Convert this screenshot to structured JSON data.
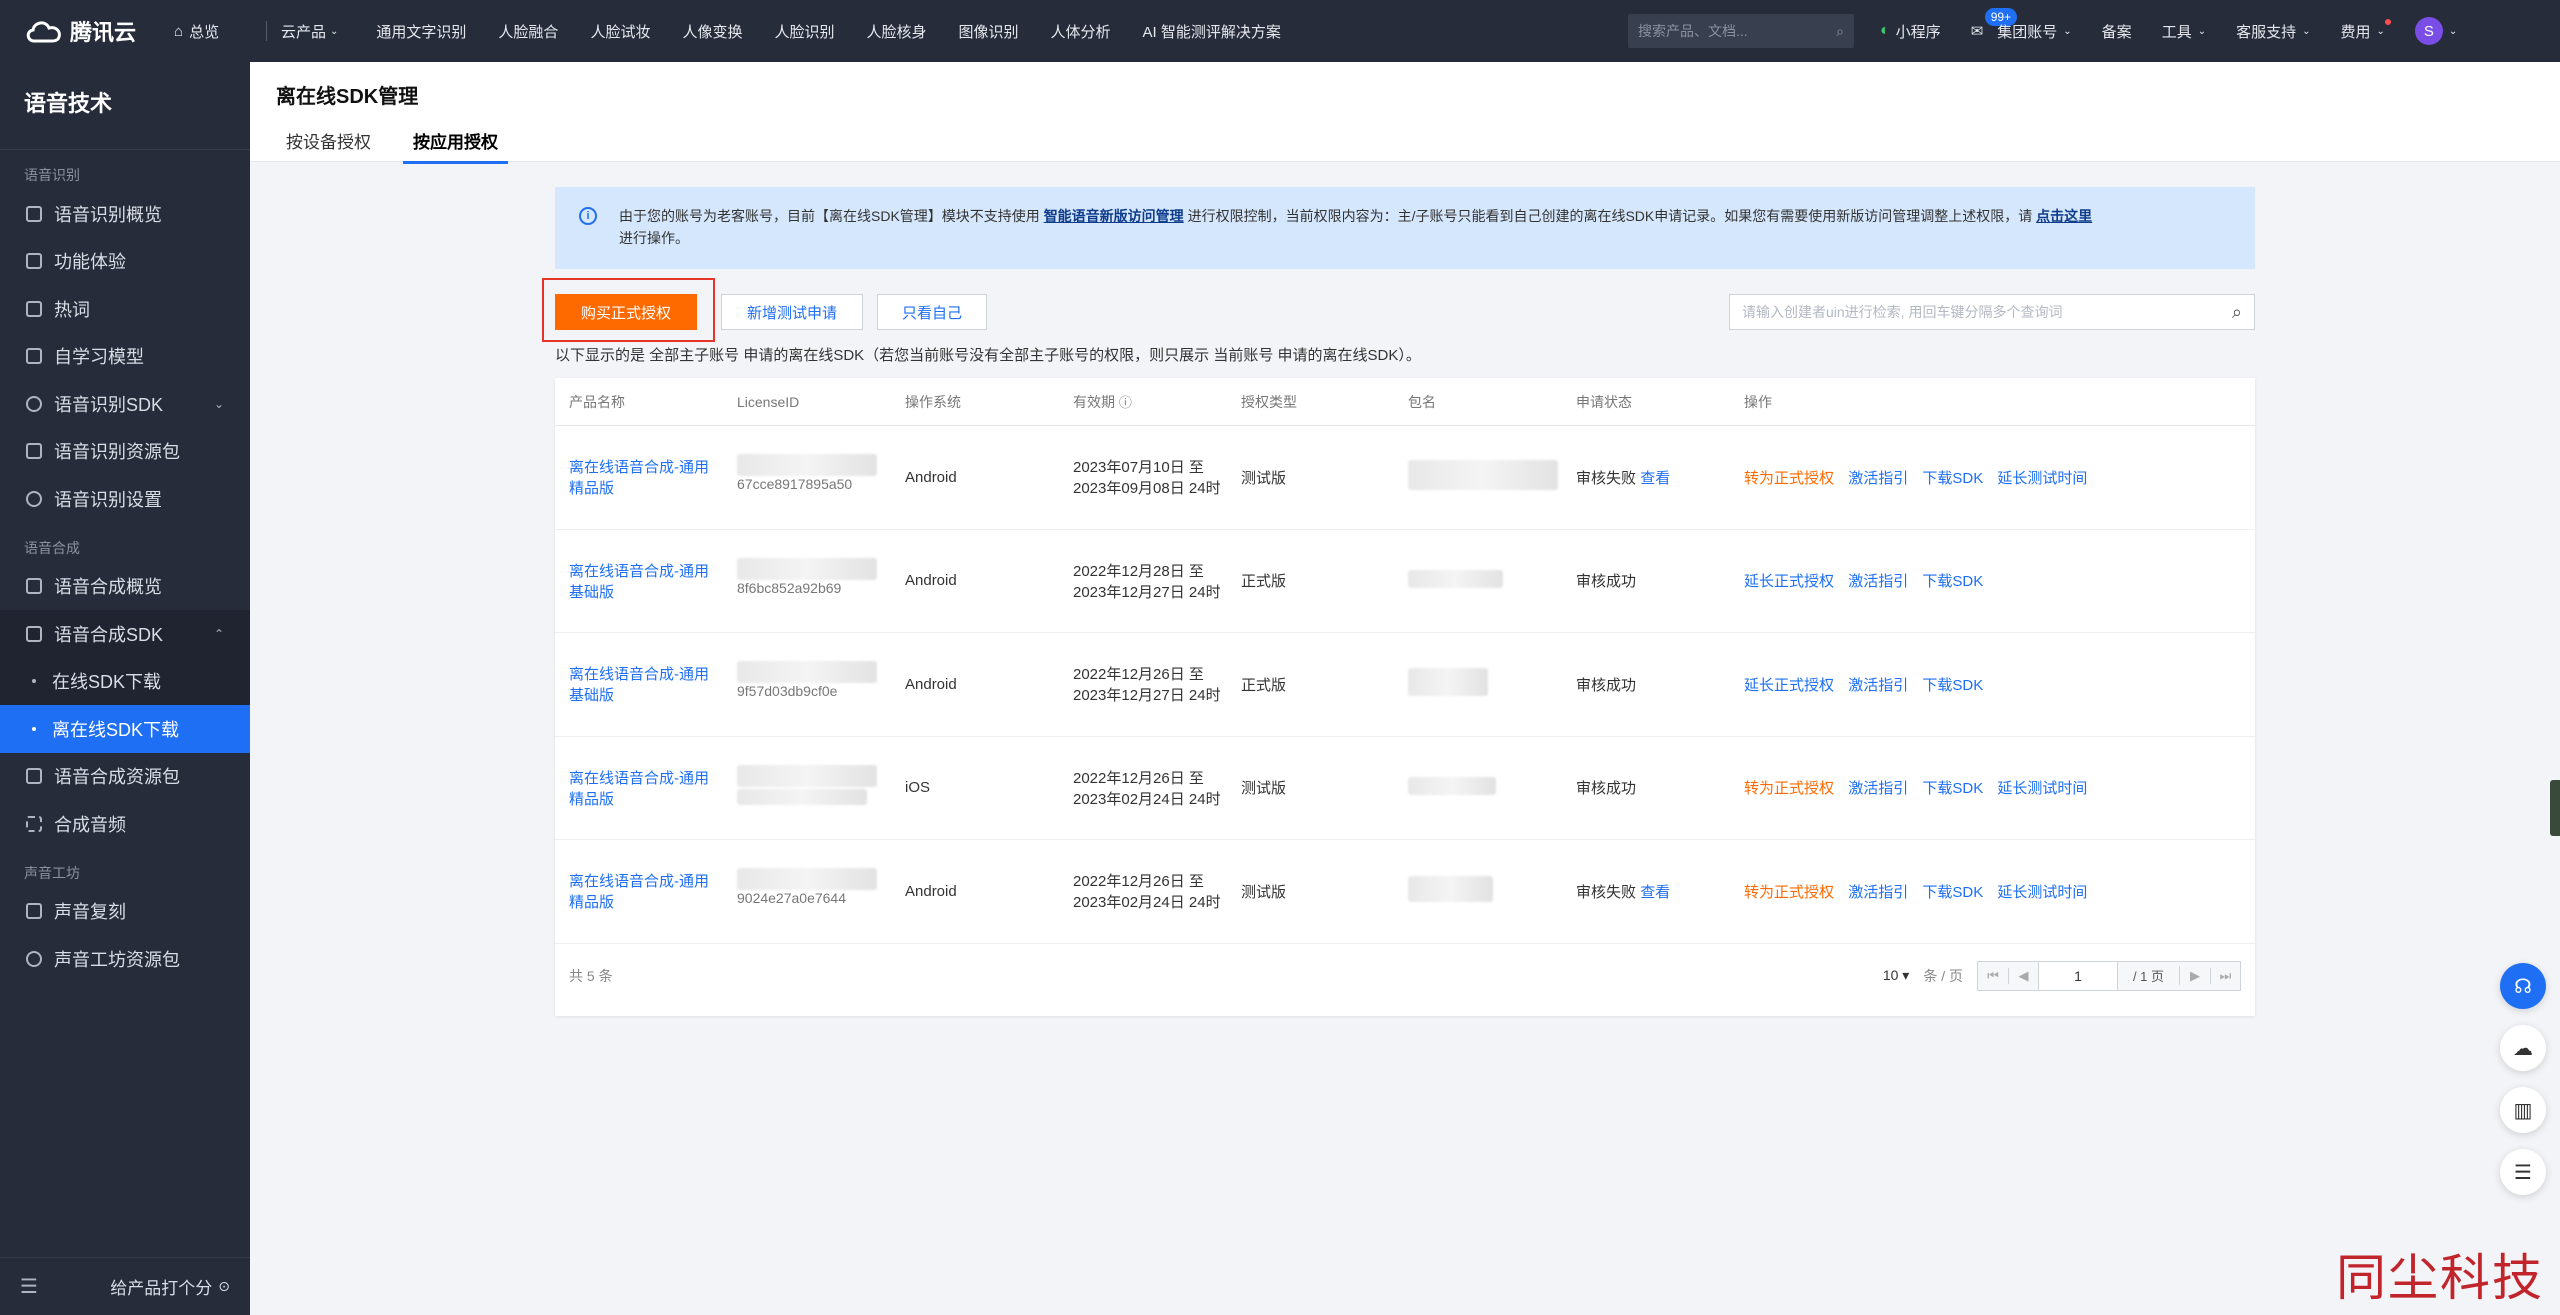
{
  "topnav": {
    "brand": "腾讯云",
    "home": "总览",
    "products": "云产品",
    "links": [
      "通用文字识别",
      "人脸融合",
      "人脸试妆",
      "人像变换",
      "人脸识别",
      "人脸核身",
      "图像识别",
      "人体分析",
      "AI 智能测评解决方案"
    ],
    "search_placeholder": "搜索产品、文档...",
    "miniprogram": "小程序",
    "mail_badge": "99+",
    "account": "集团账号",
    "filing": "备案",
    "tools": "工具",
    "support": "客服支持",
    "billing": "费用",
    "avatar_initial": "S"
  },
  "sidebar": {
    "title": "语音技术",
    "group_asr": "语音识别",
    "asr_items": [
      "语音识别概览",
      "功能体验",
      "热词",
      "自学习模型",
      "语音识别SDK",
      "语音识别资源包",
      "语音识别设置"
    ],
    "group_tts": "语音合成",
    "tts_items": [
      "语音合成概览",
      "语音合成SDK"
    ],
    "tts_sdk_sub": [
      "在线SDK下载",
      "离在线SDK下载"
    ],
    "tts_items2": [
      "语音合成资源包",
      "合成音频"
    ],
    "group_voice": "声音工坊",
    "voice_items": [
      "声音复刻",
      "声音工坊资源包"
    ],
    "bottom_label": "给产品打个分"
  },
  "page": {
    "title": "离在线SDK管理",
    "tabs": [
      "按设备授权",
      "按应用授权"
    ]
  },
  "banner": {
    "text1": "由于您的账号为老客账号，目前【离在线SDK管理】模块不支持使用 ",
    "link1": "智能语音新版访问管理",
    "text2": " 进行权限控制，当前权限内容为：主/子账号只能看到自己创建的离在线SDK申请记录。如果您有需要使用新版访问管理调整上述权限，请 ",
    "link2": "点击这里",
    "text3": "进行操作。"
  },
  "toolbar": {
    "buy": "购买正式授权",
    "new_test": "新增测试申请",
    "only_mine": "只看自己",
    "search_placeholder": "请输入创建者uin进行检索, 用回车键分隔多个查询词",
    "hint": "以下显示的是 全部主子账号 申请的离在线SDK（若您当前账号没有全部主子账号的权限，则只展示 当前账号 申请的离在线SDK）。"
  },
  "table": {
    "headers": [
      "产品名称",
      "LicenseID",
      "操作系统",
      "有效期",
      "授权类型",
      "包名",
      "申请状态",
      "操作"
    ],
    "rows": [
      {
        "product": "离在线语音合成-通用精品版",
        "license_tail": "67cce8917895a50",
        "os": "Android",
        "validity": "2023年07月10日 至 2023年09月08日 24时",
        "type": "测试版",
        "status": "审核失败",
        "status_link": "查看",
        "actions": [
          "转为正式授权",
          "激活指引",
          "下载SDK",
          "延长测试时间"
        ]
      },
      {
        "product": "离在线语音合成-通用基础版",
        "license_tail": "8f6bc852a92b69",
        "os": "Android",
        "validity": "2022年12月28日 至 2023年12月27日 24时",
        "type": "正式版",
        "status": "审核成功",
        "status_link": "",
        "actions": [
          "延长正式授权",
          "激活指引",
          "下载SDK"
        ]
      },
      {
        "product": "离在线语音合成-通用基础版",
        "license_tail": "9f57d03db9cf0e",
        "os": "Android",
        "validity": "2022年12月26日 至 2023年12月27日 24时",
        "type": "正式版",
        "status": "审核成功",
        "status_link": "",
        "actions": [
          "延长正式授权",
          "激活指引",
          "下载SDK"
        ]
      },
      {
        "product": "离在线语音合成-通用精品版",
        "license_tail": "",
        "os": "iOS",
        "validity": "2022年12月26日 至 2023年02月24日 24时",
        "type": "测试版",
        "status": "审核成功",
        "status_link": "",
        "actions": [
          "转为正式授权",
          "激活指引",
          "下载SDK",
          "延长测试时间"
        ]
      },
      {
        "product": "离在线语音合成-通用精品版",
        "license_tail": "9024e27a0e7644",
        "os": "Android",
        "validity": "2022年12月26日 至 2023年02月24日 24时",
        "type": "测试版",
        "status": "审核失败",
        "status_link": "查看",
        "actions": [
          "转为正式授权",
          "激活指引",
          "下载SDK",
          "延长测试时间"
        ]
      }
    ],
    "total": "共 5 条",
    "page_size": "10",
    "per_page_label": "条 / 页",
    "page_number": "1",
    "page_total": "/ 1 页"
  },
  "watermark": "同尘科技",
  "colors": {
    "accent": "#1e6ff4",
    "orange": "#ff6a00",
    "nav_bg": "#262c3a"
  }
}
